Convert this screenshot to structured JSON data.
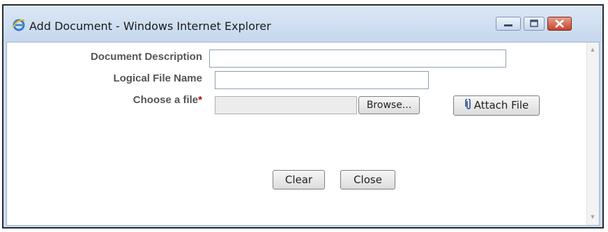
{
  "window": {
    "title": "Add Document - Windows Internet Explorer"
  },
  "form": {
    "document_description": {
      "label": "Document Description",
      "value": ""
    },
    "logical_file_name": {
      "label": "Logical File Name",
      "value": ""
    },
    "choose_file": {
      "label": "Choose a file",
      "required_mark": "*",
      "value": "",
      "browse_label": "Browse..."
    },
    "attach_label": "Attach File"
  },
  "actions": {
    "clear_label": "Clear",
    "close_label": "Close"
  },
  "icons": {
    "app": "internet-explorer-icon",
    "attach": "paperclip-icon",
    "minimize": "minimize-icon",
    "maximize": "maximize-icon",
    "close": "close-icon"
  },
  "colors": {
    "titlebar": "#c6d8ee",
    "close_button": "#c4422b",
    "required": "#c00000"
  }
}
